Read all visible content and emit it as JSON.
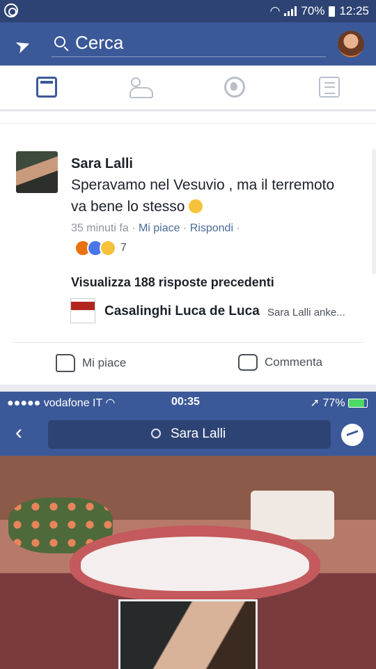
{
  "status_bar": {
    "battery": "70%",
    "time": "12:25"
  },
  "app_bar": {
    "search_placeholder": "Cerca"
  },
  "tabs": [
    "news-feed",
    "friends",
    "notifications-globe",
    "menu"
  ],
  "comment": {
    "author": "Sara Lalli",
    "text": "Speravamo nel Vesuvio , ma il terremoto va bene lo stesso",
    "time": "35 minuti fa",
    "like": "Mi piace",
    "reply": "Rispondi",
    "reaction_count": "7"
  },
  "replies": {
    "view_previous": "Visualizza 188 risposte precedenti",
    "last_reply_author": "Casalinghi Luca de Luca",
    "last_reply_text": "Sara Lalli anke..."
  },
  "actions": {
    "like": "Mi piace",
    "comment": "Commenta"
  },
  "embedded_screenshot": {
    "carrier": "vodafone IT",
    "time": "00:35",
    "battery": "77%",
    "search_text": "Sara Lalli"
  },
  "colors": {
    "facebook_blue": "#3b5998",
    "dark_blue": "#2d4373",
    "link": "#4b6a9b"
  }
}
